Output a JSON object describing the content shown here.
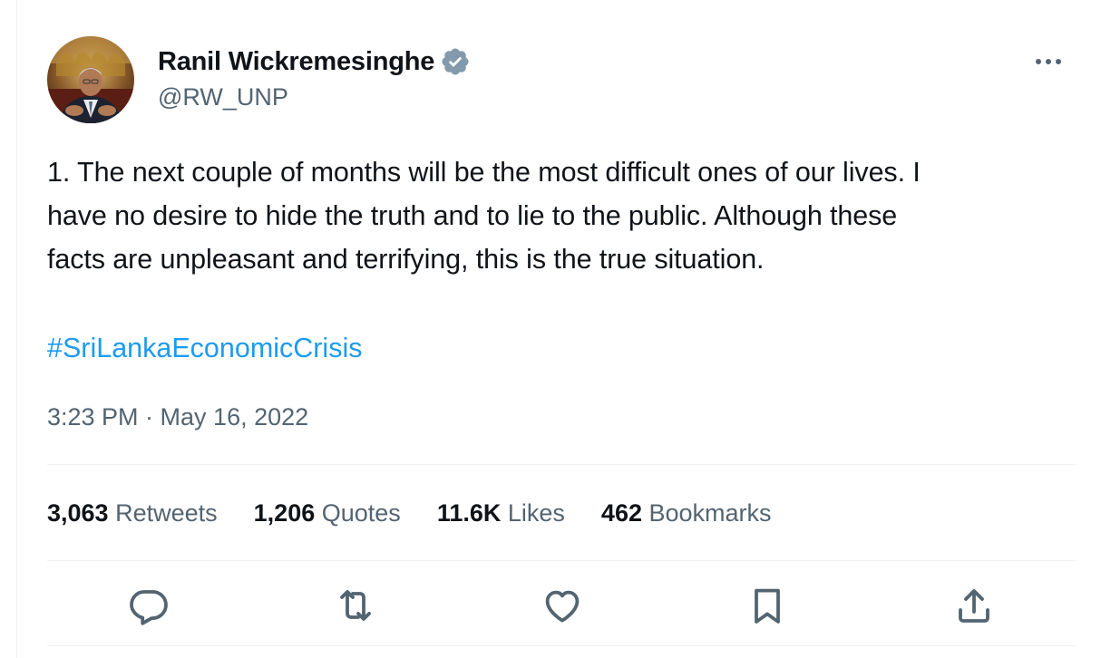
{
  "author": {
    "display_name": "Ranil Wickremesinghe",
    "handle": "@RW_UNP",
    "verified_icon": "verified-badge-icon"
  },
  "tweet": {
    "text_line_1": "1. The next couple of months will be the most difficult ones of our lives. I",
    "text_line_2": "have no desire to hide the truth and to lie to the public. Although these",
    "text_line_3": "facts are unpleasant and terrifying, this is the true situation.",
    "hashtag": "#SriLankaEconomicCrisis",
    "timestamp": "3:23 PM · May 16, 2022"
  },
  "stats": [
    {
      "count": "3,063",
      "label": "Retweets"
    },
    {
      "count": "1,206",
      "label": "Quotes"
    },
    {
      "count": "11.6K",
      "label": "Likes"
    },
    {
      "count": "462",
      "label": "Bookmarks"
    }
  ],
  "actions": [
    "reply-icon",
    "retweet-icon",
    "like-icon",
    "bookmark-icon",
    "share-icon"
  ],
  "colors": {
    "text": "#0f1419",
    "secondary": "#536471",
    "link": "#1d9bf0",
    "divider": "#eff3f4",
    "verified": "#829aab"
  }
}
